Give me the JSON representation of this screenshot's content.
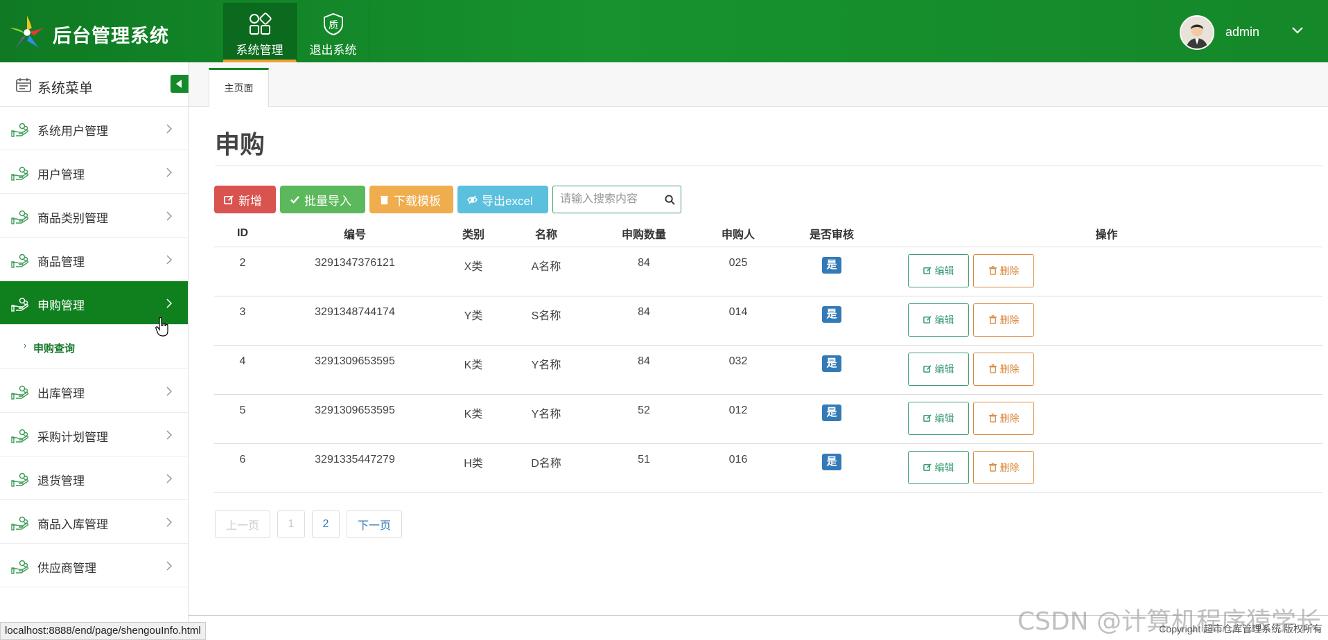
{
  "app": {
    "title": "后台管理系统"
  },
  "topnav": [
    {
      "label": "系统管理",
      "icon": "grid-icon",
      "active": true
    },
    {
      "label": "退出系统",
      "icon": "quality-shield-icon",
      "active": false
    }
  ],
  "user": {
    "name": "admin"
  },
  "sidebar": {
    "header": "系统菜单",
    "items": [
      {
        "label": "系统用户管理"
      },
      {
        "label": "用户管理"
      },
      {
        "label": "商品类别管理"
      },
      {
        "label": "商品管理"
      },
      {
        "label": "申购管理"
      },
      {
        "label": "出库管理"
      },
      {
        "label": "采购计划管理"
      },
      {
        "label": "退货管理"
      },
      {
        "label": "商品入库管理"
      },
      {
        "label": "供应商管理"
      }
    ],
    "active_sub": "申购查询"
  },
  "tabs": {
    "home": "主页面"
  },
  "page": {
    "title": "申购"
  },
  "toolbar": {
    "add": "新增",
    "batch_import": "批量导入",
    "download_template": "下载模板",
    "export_excel": "导出excel",
    "search_placeholder": "请输入搜索内容"
  },
  "table": {
    "headers": [
      "ID",
      "编号",
      "类别",
      "名称",
      "申购数量",
      "申购人",
      "是否审核",
      "操作"
    ],
    "rows": [
      {
        "id": "2",
        "code": "3291347376121",
        "category": "X类",
        "name": "A名称",
        "qty": "84",
        "buyer": "025",
        "audited": "是"
      },
      {
        "id": "3",
        "code": "3291348744174",
        "category": "Y类",
        "name": "S名称",
        "qty": "84",
        "buyer": "014",
        "audited": "是"
      },
      {
        "id": "4",
        "code": "3291309653595",
        "category": "K类",
        "name": "Y名称",
        "qty": "84",
        "buyer": "032",
        "audited": "是"
      },
      {
        "id": "5",
        "code": "3291309653595",
        "category": "K类",
        "name": "Y名称",
        "qty": "52",
        "buyer": "012",
        "audited": "是"
      },
      {
        "id": "6",
        "code": "3291335447279",
        "category": "H类",
        "name": "D名称",
        "qty": "51",
        "buyer": "016",
        "audited": "是"
      }
    ],
    "edit_label": "编辑",
    "delete_label": "删除"
  },
  "pager": {
    "prev": "上一页",
    "page1": "1",
    "page2": "2",
    "next": "下一页"
  },
  "status_url": "localhost:8888/end/page/shengouInfo.html",
  "copyright": "Copyright  超市仓库管理系统 版权所有",
  "watermark": "CSDN @计算机程序猿学长",
  "colors": {
    "header_green": "#15882a",
    "active_green": "#10801f",
    "btn_red": "#d9534f",
    "btn_green": "#5cb85c",
    "btn_orange": "#f0ad4e",
    "btn_blue": "#5bc0de",
    "badge_blue": "#337ab7"
  }
}
